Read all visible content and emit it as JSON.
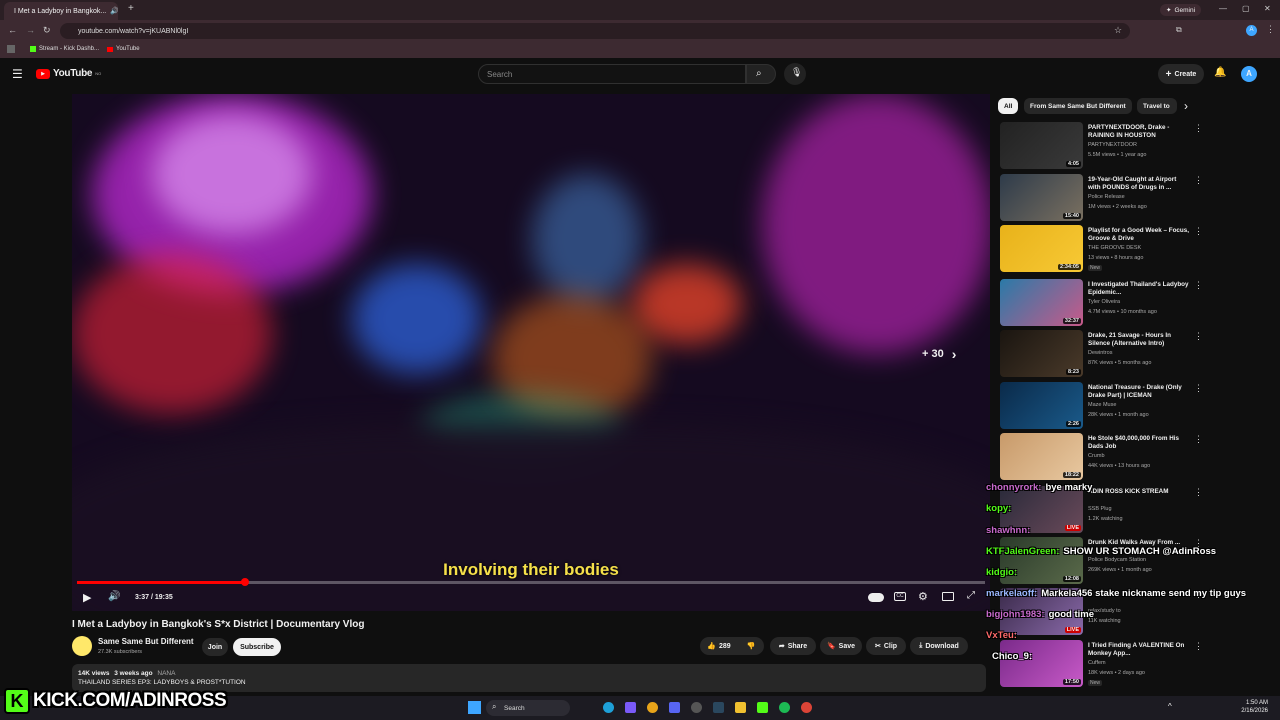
{
  "browser": {
    "tab_title": "I Met a Ladyboy in Bangkok...",
    "url": "youtube.com/watch?v=jKUABNl0lgI",
    "profile_label": "Gemini",
    "bookmarks": [
      "Stream - Kick Dashb...",
      "YouTube"
    ]
  },
  "youtube": {
    "logo": "YouTube",
    "logo_sup": "NO",
    "search_placeholder": "Search",
    "create_label": "Create",
    "avatar_letter": "A"
  },
  "player": {
    "subtitle": "Involving their bodies",
    "skip_label": "+ 30",
    "time": "3:37 / 19:35",
    "progress": 0.185
  },
  "chips": [
    "All",
    "From Same Same But Different",
    "Travel to"
  ],
  "recommendations": [
    {
      "title": "PARTYNEXTDOOR, Drake - RAINING IN HOUSTON",
      "channel": "PARTYNEXTDOOR",
      "meta": "5.5M views • 1 year ago",
      "duration": "4:05",
      "badge": "",
      "colors": [
        "#222",
        "#3a3a3a"
      ]
    },
    {
      "title": "19-Year-Old Caught at Airport with POUNDS of Drugs in ...",
      "channel": "Police Release",
      "meta": "1M views • 2 weeks ago",
      "duration": "15:40",
      "badge": "",
      "colors": [
        "#2e3b4a",
        "#7a7060"
      ]
    },
    {
      "title": "Playlist for a Good Week – Focus, Groove & Drive",
      "channel": "THE GROOVE DESK",
      "meta": "13 views • 8 hours ago",
      "duration": "2:34:05",
      "badge": "New",
      "colors": [
        "#e8b21a",
        "#f7c935"
      ]
    },
    {
      "title": "I Investigated Thailand's Ladyboy Epidemic...",
      "channel": "Tyler Oliveira",
      "meta": "4.7M views • 10 months ago",
      "duration": "32:37",
      "badge": "",
      "colors": [
        "#2a7aa8",
        "#c85a8a"
      ]
    },
    {
      "title": "Drake, 21 Savage - Hours In Silence (Alternative Intro)",
      "channel": "Dewintros",
      "meta": "87K views • 5 months ago",
      "duration": "8:23",
      "badge": "",
      "colors": [
        "#1a1510",
        "#4a3a2a"
      ]
    },
    {
      "title": "National Treasure - Drake (Only Drake Part) | ICEMAN",
      "channel": "Maze Muse",
      "meta": "28K views • 1 month ago",
      "duration": "2:26",
      "badge": "",
      "colors": [
        "#0a2a4a",
        "#1a5a8a"
      ]
    },
    {
      "title": "He Stole $40,000,000 From His Dads Job",
      "channel": "Crumb",
      "meta": "44K views • 13 hours ago",
      "duration": "18:22",
      "badge": "",
      "colors": [
        "#c89a6a",
        "#e8c8a0"
      ]
    },
    {
      "title": "ADIN ROSS KICK STREAM",
      "channel": "SSB Plug",
      "meta": "1.2K watching",
      "duration": "LIVE",
      "badge": "",
      "colors": [
        "#2a2a3a",
        "#6a4a5a"
      ]
    },
    {
      "title": "Drunk Kid Walks Away From ...",
      "channel": "Police Bodycam Station",
      "meta": "269K views • 1 month ago",
      "duration": "12:08",
      "badge": "",
      "colors": [
        "#2a3a2a",
        "#5a6a4a"
      ]
    },
    {
      "title": "",
      "channel": "relax/study to",
      "meta": "11K watching",
      "duration": "LIVE",
      "badge": "",
      "colors": [
        "#3a2a4a",
        "#8a6aaa"
      ]
    },
    {
      "title": "I Tried Finding A VALENTINE On Monkey App...",
      "channel": "Cuffem",
      "meta": "18K views • 2 days ago",
      "duration": "17:50",
      "badge": "New",
      "colors": [
        "#7a2a8a",
        "#c85ac8"
      ]
    }
  ],
  "video": {
    "title": "I Met a Ladyboy in Bangkok's S*x District | Documentary Vlog",
    "channel": "Same Same But Different",
    "subscribers": "27.3K subscribers",
    "join_label": "Join",
    "subscribe_label": "Subscribe",
    "likes": "289",
    "share_label": "Share",
    "save_label": "Save",
    "clip_label": "Clip",
    "download_label": "Download",
    "views": "14K views",
    "date": "3 weeks ago",
    "tag": "NANA",
    "desc_line": "THAILAND SERIES EP3: LADYBOYS & PROST*TUTION"
  },
  "chat": [
    {
      "user": "chonnyrork:",
      "msg": "bye marky",
      "color": "#c86acc"
    },
    {
      "user": "kopy:",
      "msg": "",
      "color": "#53fc18"
    },
    {
      "user": "shawhnn:",
      "msg": "",
      "color": "#c86acc"
    },
    {
      "user": "KTFJalenGreen:",
      "msg": "SHOW UR STOMACH @AdinRoss",
      "color": "#53fc18"
    },
    {
      "user": "kidgio:",
      "msg": "",
      "color": "#53fc18"
    },
    {
      "user": "markelaoff:",
      "msg": "Markela456 stake nickname send my tip guys",
      "color": "#9ab8ff"
    },
    {
      "user": "bigjohn1983:",
      "msg": "good time",
      "color": "#c86acc"
    },
    {
      "user": "VxTeu:",
      "msg": "",
      "color": "#ff6a6a"
    },
    {
      "user": "Chico_9:",
      "msg": "",
      "color": "#fff"
    }
  ],
  "kick_banner": "KICK.COM/ADINROSS",
  "taskbar": {
    "search_label": "Search",
    "time": "1:50 AM",
    "date": "2/16/2026"
  }
}
